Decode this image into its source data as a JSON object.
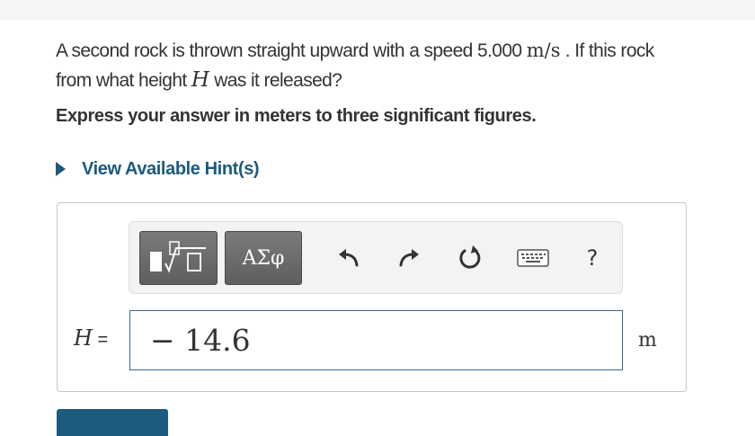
{
  "question": {
    "line1_text": "A second rock is thrown straight upward with a speed 5.000 ",
    "speed_unit": "m/s",
    "line1_tail": " . If this rock",
    "line2_before": "from what height ",
    "height_symbol": "H",
    "line2_after": " was it released?"
  },
  "instruction": "Express your answer in meters to three significant figures.",
  "hint": {
    "label": "View Available Hint(s)"
  },
  "toolbar": {
    "symbols_label": "ΑΣφ",
    "help_label": "?",
    "icons": [
      "templates-icon",
      "undo-icon",
      "redo-icon",
      "reset-icon",
      "keyboard-icon",
      "help-icon"
    ]
  },
  "answer": {
    "variable": "H",
    "equals": "=",
    "value": "− 14.6",
    "unit": "m"
  },
  "colors": {
    "link": "#1d5a7d",
    "button_dark": "#5e5e5e",
    "input_border": "#2d6f9a",
    "text": "#333333"
  }
}
